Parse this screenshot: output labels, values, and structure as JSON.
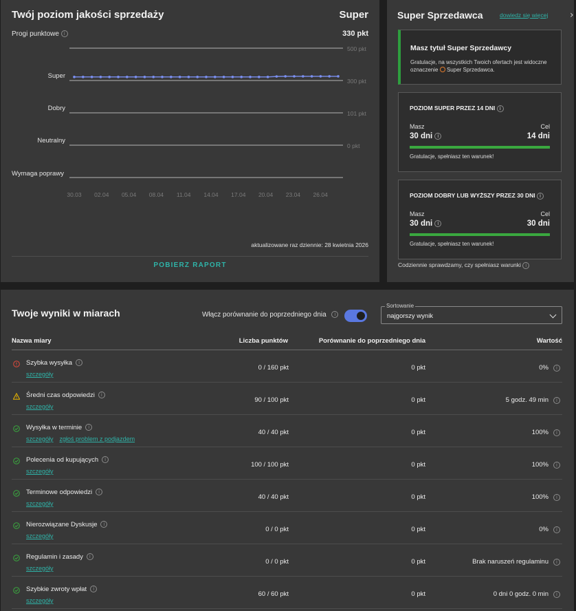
{
  "quality": {
    "title": "Twój poziom jakości sprzedaży",
    "level": "Super",
    "threshold_label": "Progi punktowe",
    "points": "330 pkt",
    "updated_note": "aktualizowane raz dziennie: 28 kwietnia 2026",
    "download_label": "POBIERZ RAPORT"
  },
  "chart_data": {
    "type": "line",
    "title": "",
    "levels": [
      "Super",
      "Dobry",
      "Neutralny",
      "Wymaga poprawy"
    ],
    "threshold_ticks": [
      "500 pkt",
      "300 pkt",
      "101 pkt",
      "0 pkt"
    ],
    "threshold_values": [
      500,
      300,
      101,
      0
    ],
    "x_tick_labels": [
      "30.03",
      "02.04",
      "05.04",
      "08.04",
      "11.04",
      "14.04",
      "17.04",
      "20.04",
      "23.04",
      "26.04"
    ],
    "series": [
      {
        "values": [
          322,
          322,
          322,
          322,
          322,
          322,
          322,
          322,
          322,
          322,
          322,
          322,
          322,
          322,
          322,
          322,
          322,
          322,
          322,
          322,
          322,
          322,
          322,
          325,
          326,
          326,
          326,
          326,
          326,
          326,
          326
        ]
      }
    ],
    "colors": {
      "line": "#7b8ff0",
      "threshold_line": "#9a9a9a"
    },
    "grid": true
  },
  "super_seller": {
    "title": "Super Sprzedawca",
    "learn_more": "dowiedz się więcej",
    "badge_box": {
      "title": "Masz tytuł Super Sprzedawcy",
      "desc_pre": "Gratulacje, na wszystkich Twoich ofertach jest widoczne oznaczenie",
      "desc_post": "Super Sprzedawca."
    },
    "boxes": [
      {
        "title": "POZIOM SUPER PRZEZ 14 DNI",
        "have_label": "Masz",
        "have": "30 dni",
        "goal_label": "Cel",
        "goal": "14 dni",
        "progress": 1.0,
        "note": "Gratulacje, spełniasz ten warunek!"
      },
      {
        "title": "POZIOM DOBRY LUB WYŻSZY PRZEZ 30 DNI",
        "have_label": "Masz",
        "have": "30 dni",
        "goal_label": "Cel",
        "goal": "30 dni",
        "progress": 1.0,
        "note": "Gratulacje, spełniasz ten warunek!"
      }
    ],
    "daily_check": "Codziennie sprawdzamy, czy spełniasz warunki"
  },
  "metrics": {
    "title": "Twoje wyniki w miarach",
    "compare_label": "Włącz porównanie do poprzedniego dnia",
    "compare_enabled": true,
    "sort_legend": "Sortowanie",
    "sort_value": "najgorszy wynik",
    "columns": [
      "Nazwa miary",
      "Liczba punktów",
      "Porównanie do poprzedniego dnia",
      "Wartość"
    ],
    "rows": [
      {
        "status": "error",
        "name": "Szybka wysyłka",
        "links": [
          "szczegóły"
        ],
        "points": "0 / 160 pkt",
        "compare": "0 pkt",
        "value": "0%"
      },
      {
        "status": "warning",
        "name": "Średni czas odpowiedzi",
        "links": [
          "szczegóły"
        ],
        "points": "90 / 100 pkt",
        "compare": "0 pkt",
        "value": "5 godz. 49 min"
      },
      {
        "status": "ok",
        "name": "Wysyłka w terminie",
        "links": [
          "szczegóły",
          "zgłoś problem z podjazdem"
        ],
        "points": "40 / 40 pkt",
        "compare": "0 pkt",
        "value": "100%"
      },
      {
        "status": "ok",
        "name": "Polecenia od kupujących",
        "links": [
          "szczegóły"
        ],
        "points": "100 / 100 pkt",
        "compare": "0 pkt",
        "value": "100%"
      },
      {
        "status": "ok",
        "name": "Terminowe odpowiedzi",
        "links": [
          "szczegóły"
        ],
        "points": "40 / 40 pkt",
        "compare": "0 pkt",
        "value": "100%"
      },
      {
        "status": "ok",
        "name": "Nierozwiązane Dyskusje",
        "links": [
          "szczegóły"
        ],
        "points": "0 / 0 pkt",
        "compare": "0 pkt",
        "value": "0%"
      },
      {
        "status": "ok",
        "name": "Regulamin i zasady",
        "links": [
          "szczegóły"
        ],
        "points": "0 / 0 pkt",
        "compare": "0 pkt",
        "value": "Brak naruszeń regulaminu"
      },
      {
        "status": "ok",
        "name": "Szybkie zwroty wpłat",
        "links": [
          "szczegóły"
        ],
        "points": "60 / 60 pkt",
        "compare": "0 pkt",
        "value": "0 dni 0 godz. 0 min"
      }
    ],
    "status_colors": {
      "error": "#e04a3c",
      "warning": "#e8b400",
      "ok": "#3aa83f"
    }
  }
}
